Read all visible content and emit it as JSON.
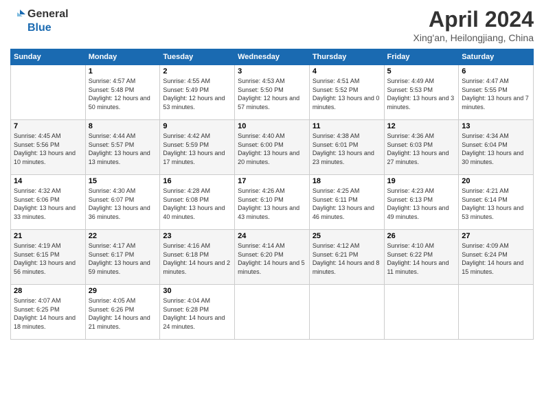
{
  "header": {
    "logo_line1": "General",
    "logo_line2": "Blue",
    "month": "April 2024",
    "location": "Xing'an, Heilongjiang, China"
  },
  "weekdays": [
    "Sunday",
    "Monday",
    "Tuesday",
    "Wednesday",
    "Thursday",
    "Friday",
    "Saturday"
  ],
  "weeks": [
    [
      {
        "day": "",
        "sunrise": "",
        "sunset": "",
        "daylight": ""
      },
      {
        "day": "1",
        "sunrise": "Sunrise: 4:57 AM",
        "sunset": "Sunset: 5:48 PM",
        "daylight": "Daylight: 12 hours and 50 minutes."
      },
      {
        "day": "2",
        "sunrise": "Sunrise: 4:55 AM",
        "sunset": "Sunset: 5:49 PM",
        "daylight": "Daylight: 12 hours and 53 minutes."
      },
      {
        "day": "3",
        "sunrise": "Sunrise: 4:53 AM",
        "sunset": "Sunset: 5:50 PM",
        "daylight": "Daylight: 12 hours and 57 minutes."
      },
      {
        "day": "4",
        "sunrise": "Sunrise: 4:51 AM",
        "sunset": "Sunset: 5:52 PM",
        "daylight": "Daylight: 13 hours and 0 minutes."
      },
      {
        "day": "5",
        "sunrise": "Sunrise: 4:49 AM",
        "sunset": "Sunset: 5:53 PM",
        "daylight": "Daylight: 13 hours and 3 minutes."
      },
      {
        "day": "6",
        "sunrise": "Sunrise: 4:47 AM",
        "sunset": "Sunset: 5:55 PM",
        "daylight": "Daylight: 13 hours and 7 minutes."
      }
    ],
    [
      {
        "day": "7",
        "sunrise": "Sunrise: 4:45 AM",
        "sunset": "Sunset: 5:56 PM",
        "daylight": "Daylight: 13 hours and 10 minutes."
      },
      {
        "day": "8",
        "sunrise": "Sunrise: 4:44 AM",
        "sunset": "Sunset: 5:57 PM",
        "daylight": "Daylight: 13 hours and 13 minutes."
      },
      {
        "day": "9",
        "sunrise": "Sunrise: 4:42 AM",
        "sunset": "Sunset: 5:59 PM",
        "daylight": "Daylight: 13 hours and 17 minutes."
      },
      {
        "day": "10",
        "sunrise": "Sunrise: 4:40 AM",
        "sunset": "Sunset: 6:00 PM",
        "daylight": "Daylight: 13 hours and 20 minutes."
      },
      {
        "day": "11",
        "sunrise": "Sunrise: 4:38 AM",
        "sunset": "Sunset: 6:01 PM",
        "daylight": "Daylight: 13 hours and 23 minutes."
      },
      {
        "day": "12",
        "sunrise": "Sunrise: 4:36 AM",
        "sunset": "Sunset: 6:03 PM",
        "daylight": "Daylight: 13 hours and 27 minutes."
      },
      {
        "day": "13",
        "sunrise": "Sunrise: 4:34 AM",
        "sunset": "Sunset: 6:04 PM",
        "daylight": "Daylight: 13 hours and 30 minutes."
      }
    ],
    [
      {
        "day": "14",
        "sunrise": "Sunrise: 4:32 AM",
        "sunset": "Sunset: 6:06 PM",
        "daylight": "Daylight: 13 hours and 33 minutes."
      },
      {
        "day": "15",
        "sunrise": "Sunrise: 4:30 AM",
        "sunset": "Sunset: 6:07 PM",
        "daylight": "Daylight: 13 hours and 36 minutes."
      },
      {
        "day": "16",
        "sunrise": "Sunrise: 4:28 AM",
        "sunset": "Sunset: 6:08 PM",
        "daylight": "Daylight: 13 hours and 40 minutes."
      },
      {
        "day": "17",
        "sunrise": "Sunrise: 4:26 AM",
        "sunset": "Sunset: 6:10 PM",
        "daylight": "Daylight: 13 hours and 43 minutes."
      },
      {
        "day": "18",
        "sunrise": "Sunrise: 4:25 AM",
        "sunset": "Sunset: 6:11 PM",
        "daylight": "Daylight: 13 hours and 46 minutes."
      },
      {
        "day": "19",
        "sunrise": "Sunrise: 4:23 AM",
        "sunset": "Sunset: 6:13 PM",
        "daylight": "Daylight: 13 hours and 49 minutes."
      },
      {
        "day": "20",
        "sunrise": "Sunrise: 4:21 AM",
        "sunset": "Sunset: 6:14 PM",
        "daylight": "Daylight: 13 hours and 53 minutes."
      }
    ],
    [
      {
        "day": "21",
        "sunrise": "Sunrise: 4:19 AM",
        "sunset": "Sunset: 6:15 PM",
        "daylight": "Daylight: 13 hours and 56 minutes."
      },
      {
        "day": "22",
        "sunrise": "Sunrise: 4:17 AM",
        "sunset": "Sunset: 6:17 PM",
        "daylight": "Daylight: 13 hours and 59 minutes."
      },
      {
        "day": "23",
        "sunrise": "Sunrise: 4:16 AM",
        "sunset": "Sunset: 6:18 PM",
        "daylight": "Daylight: 14 hours and 2 minutes."
      },
      {
        "day": "24",
        "sunrise": "Sunrise: 4:14 AM",
        "sunset": "Sunset: 6:20 PM",
        "daylight": "Daylight: 14 hours and 5 minutes."
      },
      {
        "day": "25",
        "sunrise": "Sunrise: 4:12 AM",
        "sunset": "Sunset: 6:21 PM",
        "daylight": "Daylight: 14 hours and 8 minutes."
      },
      {
        "day": "26",
        "sunrise": "Sunrise: 4:10 AM",
        "sunset": "Sunset: 6:22 PM",
        "daylight": "Daylight: 14 hours and 11 minutes."
      },
      {
        "day": "27",
        "sunrise": "Sunrise: 4:09 AM",
        "sunset": "Sunset: 6:24 PM",
        "daylight": "Daylight: 14 hours and 15 minutes."
      }
    ],
    [
      {
        "day": "28",
        "sunrise": "Sunrise: 4:07 AM",
        "sunset": "Sunset: 6:25 PM",
        "daylight": "Daylight: 14 hours and 18 minutes."
      },
      {
        "day": "29",
        "sunrise": "Sunrise: 4:05 AM",
        "sunset": "Sunset: 6:26 PM",
        "daylight": "Daylight: 14 hours and 21 minutes."
      },
      {
        "day": "30",
        "sunrise": "Sunrise: 4:04 AM",
        "sunset": "Sunset: 6:28 PM",
        "daylight": "Daylight: 14 hours and 24 minutes."
      },
      {
        "day": "",
        "sunrise": "",
        "sunset": "",
        "daylight": ""
      },
      {
        "day": "",
        "sunrise": "",
        "sunset": "",
        "daylight": ""
      },
      {
        "day": "",
        "sunrise": "",
        "sunset": "",
        "daylight": ""
      },
      {
        "day": "",
        "sunrise": "",
        "sunset": "",
        "daylight": ""
      }
    ]
  ]
}
